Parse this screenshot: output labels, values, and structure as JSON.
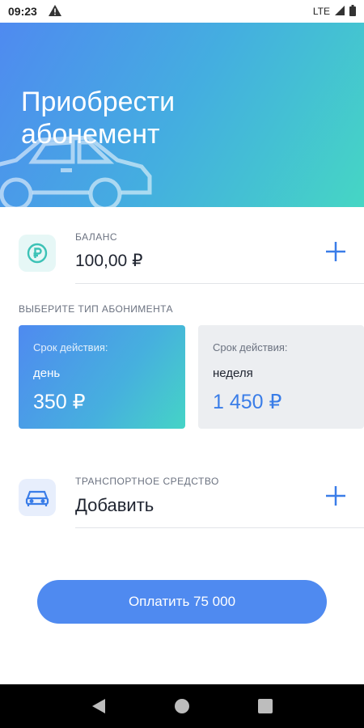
{
  "status_bar": {
    "time": "09:23",
    "network": "LTE"
  },
  "header": {
    "title": "Приобрести абонемент"
  },
  "balance": {
    "caption": "БАЛАНС",
    "value": "100,00 ₽",
    "icon": "ruble-icon"
  },
  "subscription": {
    "section_label": "ВЫБЕРИТЕ ТИП АБОНИМЕНТА",
    "options": [
      {
        "caption": "Срок действия:",
        "period": "день",
        "price": "350 ₽",
        "selected": true
      },
      {
        "caption": "Срок действия:",
        "period": "неделя",
        "price": "1 450 ₽",
        "selected": false
      }
    ]
  },
  "vehicle": {
    "caption": "ТРАНСПОРТНОЕ СРЕДСТВО",
    "value": "Добавить",
    "icon": "car-icon"
  },
  "pay_button": {
    "label": "Оплатить 75 000"
  },
  "colors": {
    "accent": "#4f8af0",
    "teal": "#45d6c4",
    "price_blue": "#3a7de8"
  }
}
